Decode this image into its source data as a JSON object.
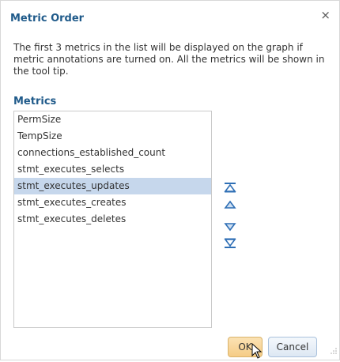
{
  "dialog": {
    "title": "Metric Order",
    "close_glyph": "×",
    "description": "The first 3 metrics in the list will be displayed on the graph if metric annotations are turned on. All the metrics will be shown in the tool tip.",
    "metrics_label": "Metrics"
  },
  "metrics": {
    "items": [
      {
        "label": "PermSize"
      },
      {
        "label": "TempSize"
      },
      {
        "label": "connections_established_count"
      },
      {
        "label": "stmt_executes_selects"
      },
      {
        "label": "stmt_executes_updates",
        "selected": true
      },
      {
        "label": "stmt_executes_creates"
      },
      {
        "label": "stmt_executes_deletes"
      }
    ]
  },
  "icons": {
    "move_top": "move-to-top-icon",
    "move_up": "move-up-icon",
    "move_down": "move-down-icon",
    "move_bottom": "move-to-bottom-icon",
    "cursor": "mouse-pointer-icon"
  },
  "footer": {
    "ok_label": "OK",
    "cancel_label": "Cancel"
  },
  "colors": {
    "title": "#1f5a8a",
    "selection": "#c6d7ec",
    "arrow": "#2f6fb5",
    "ok_bg": "#f5cc86",
    "cancel_bg": "#dde7f3"
  }
}
